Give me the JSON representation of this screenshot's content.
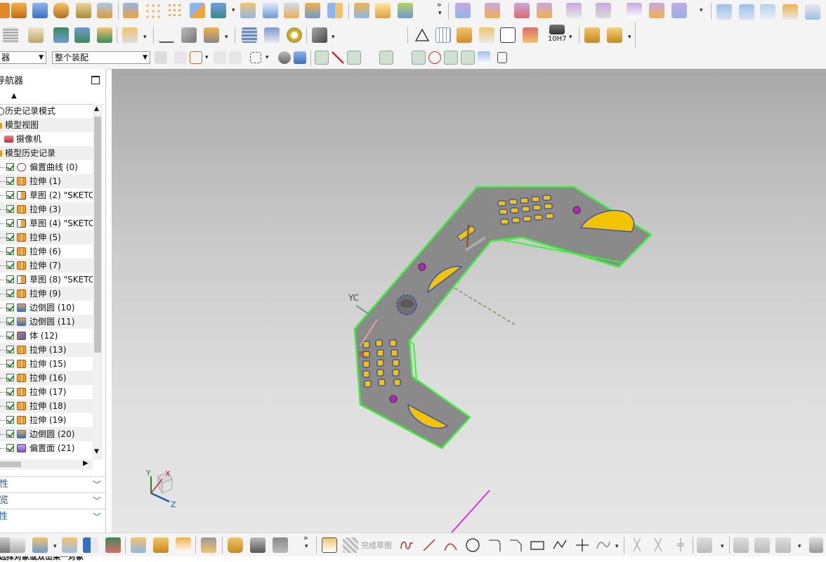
{
  "toolbar": {
    "filter_select": "器",
    "assembly_select": "整个装配",
    "hole_spec_label": "10H7",
    "finish_sketch_label": "完成草图"
  },
  "navigator": {
    "title": "导航器",
    "history_mode": "历史记录模式",
    "model_views": "模型视图",
    "camera": "摄像机",
    "model_history": "模型历史记录",
    "features": [
      {
        "label": "偏置曲线 (0)",
        "type": "offset-curve"
      },
      {
        "label": "拉伸 (1)",
        "type": "extrude"
      },
      {
        "label": "草图 (2) \"SKETC",
        "type": "sketch"
      },
      {
        "label": "拉伸 (3)",
        "type": "extrude"
      },
      {
        "label": "草图 (4) \"SKETC",
        "type": "sketch"
      },
      {
        "label": "拉伸 (5)",
        "type": "extrude"
      },
      {
        "label": "拉伸 (6)",
        "type": "extrude"
      },
      {
        "label": "拉伸 (7)",
        "type": "extrude"
      },
      {
        "label": "草图 (8) \"SKETC",
        "type": "sketch"
      },
      {
        "label": "拉伸 (9)",
        "type": "extrude"
      },
      {
        "label": "边倒圆 (10)",
        "type": "blend"
      },
      {
        "label": "边倒圆 (11)",
        "type": "blend"
      },
      {
        "label": "体 (12)",
        "type": "body"
      },
      {
        "label": "拉伸 (13)",
        "type": "extrude"
      },
      {
        "label": "拉伸 (15)",
        "type": "extrude"
      },
      {
        "label": "拉伸 (16)",
        "type": "extrude"
      },
      {
        "label": "拉伸 (17)",
        "type": "extrude"
      },
      {
        "label": "拉伸 (18)",
        "type": "extrude"
      },
      {
        "label": "拉伸 (19)",
        "type": "extrude"
      },
      {
        "label": "边倒圆 (20)",
        "type": "blend"
      },
      {
        "label": "偏置面 (21)",
        "type": "offset-face"
      }
    ],
    "panels": [
      "属性",
      "预览",
      "相关性"
    ]
  },
  "viewport": {
    "yc_label": "YC",
    "xc_label": "XC",
    "triad": {
      "x": "X",
      "y": "Y",
      "z": "Z"
    }
  },
  "status": {
    "message": "选择对象或双击某一对象"
  },
  "colors": {
    "part_fill": "#8a8a8a",
    "part_edge": "#3cf03c",
    "component_yellow": "#f2c400",
    "accent_blue": "#1e5aa8",
    "check_green": "#1a8a1a"
  }
}
